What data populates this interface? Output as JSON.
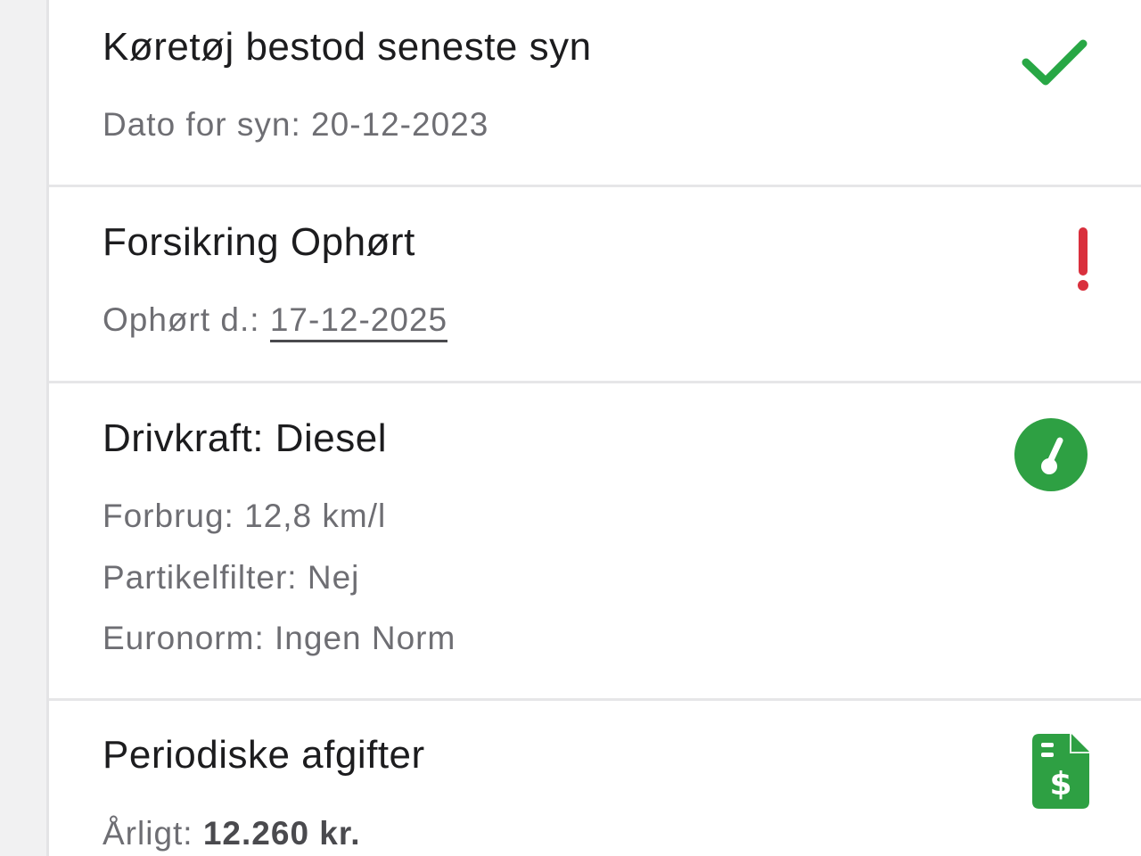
{
  "inspection": {
    "title": "Køretøj bestod seneste syn",
    "date_label": "Dato for syn:",
    "date_value": "20-12-2023",
    "icon": "checkmark-icon",
    "icon_color": "#28a745"
  },
  "insurance": {
    "title": "Forsikring Ophørt",
    "ended_label": "Ophørt d.:",
    "ended_value": "17-12-2025",
    "icon": "exclamation-icon",
    "icon_color": "#d9303d"
  },
  "fuel": {
    "title": "Drivkraft: Diesel",
    "consumption_label": "Forbrug:",
    "consumption_value": "12,8 km/l",
    "particle_filter_label": "Partikelfilter:",
    "particle_filter_value": "Nej",
    "euronorm_label": "Euronorm:",
    "euronorm_value": "Ingen Norm",
    "icon": "gauge-icon",
    "icon_color": "#2ea043"
  },
  "fees": {
    "title": "Periodiske afgifter",
    "yearly_label": "Årligt:",
    "yearly_value": "12.260 kr.",
    "icon": "invoice-dollar-icon",
    "icon_color": "#2ea043"
  }
}
